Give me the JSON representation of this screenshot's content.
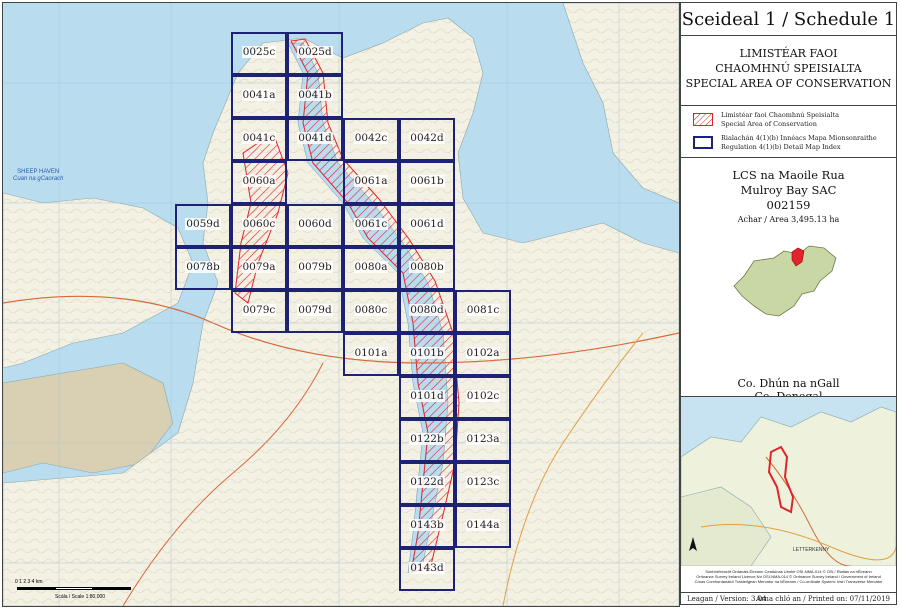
{
  "title": "Sceideal 1 / Schedule 1",
  "designation": {
    "line1": "LIMISTÉAR FAOI",
    "line2": "CHAOMHNÚ SPEISIALTA",
    "line3": "SPECIAL AREA OF CONSERVATION"
  },
  "legend": [
    {
      "line1": "Limistéar faoi Chaomhnú Speisialta",
      "line2": "Special Area of Conservation",
      "swatch": "hatch"
    },
    {
      "line1": "Rialachán 4(1)(b) Innéacs Mapa Mionsonraithe",
      "line2": "Regulation 4(1)(b) Detail Map Index",
      "swatch": "box"
    }
  ],
  "site": {
    "name_ga": "LCS na Maoile Rua",
    "name_en": "Mulroy Bay SAC",
    "code": "002159",
    "area": "Achar / Area 3,495.13 ha"
  },
  "county": {
    "ga": "Co. Dhún na nGall",
    "en": "Co. Donegal"
  },
  "map_labels": {
    "sheep_haven": "SHEEP HAVEN",
    "cuan": "Cuan na gCaorach",
    "letterkenny": "LETTERKENNY"
  },
  "scale": {
    "ticks": "0     1     2     3     4 km",
    "caption": "Scála / Scale 1:80,000"
  },
  "grid_cells": [
    {
      "label": "0025c",
      "col": 0,
      "row": 0
    },
    {
      "label": "0025d",
      "col": 1,
      "row": 0
    },
    {
      "label": "0041a",
      "col": 0,
      "row": 1
    },
    {
      "label": "0041b",
      "col": 1,
      "row": 1
    },
    {
      "label": "0041c",
      "col": 0,
      "row": 2
    },
    {
      "label": "0041d",
      "col": 1,
      "row": 2
    },
    {
      "label": "0042c",
      "col": 2,
      "row": 2
    },
    {
      "label": "0042d",
      "col": 3,
      "row": 2
    },
    {
      "label": "0060a",
      "col": 0,
      "row": 3
    },
    {
      "label": "0061a",
      "col": 2,
      "row": 3
    },
    {
      "label": "0061b",
      "col": 3,
      "row": 3
    },
    {
      "label": "0059d",
      "col": -1,
      "row": 4
    },
    {
      "label": "0060c",
      "col": 0,
      "row": 4
    },
    {
      "label": "0060d",
      "col": 1,
      "row": 4
    },
    {
      "label": "0061c",
      "col": 2,
      "row": 4
    },
    {
      "label": "0061d",
      "col": 3,
      "row": 4
    },
    {
      "label": "0078b",
      "col": -1,
      "row": 5
    },
    {
      "label": "0079a",
      "col": 0,
      "row": 5
    },
    {
      "label": "0079b",
      "col": 1,
      "row": 5
    },
    {
      "label": "0080a",
      "col": 2,
      "row": 5
    },
    {
      "label": "0080b",
      "col": 3,
      "row": 5
    },
    {
      "label": "0079c",
      "col": 0,
      "row": 6
    },
    {
      "label": "0079d",
      "col": 1,
      "row": 6
    },
    {
      "label": "0080c",
      "col": 2,
      "row": 6
    },
    {
      "label": "0080d",
      "col": 3,
      "row": 6
    },
    {
      "label": "0081c",
      "col": 4,
      "row": 6
    },
    {
      "label": "0101a",
      "col": 2,
      "row": 7
    },
    {
      "label": "0101b",
      "col": 3,
      "row": 7
    },
    {
      "label": "0102a",
      "col": 4,
      "row": 7
    },
    {
      "label": "0101d",
      "col": 3,
      "row": 8
    },
    {
      "label": "0102c",
      "col": 4,
      "row": 8
    },
    {
      "label": "0122b",
      "col": 3,
      "row": 9
    },
    {
      "label": "0123a",
      "col": 4,
      "row": 9
    },
    {
      "label": "0122d",
      "col": 3,
      "row": 10
    },
    {
      "label": "0123c",
      "col": 4,
      "row": 10
    },
    {
      "label": "0143b",
      "col": 3,
      "row": 11
    },
    {
      "label": "0144a",
      "col": 4,
      "row": 11
    },
    {
      "label": "0143d",
      "col": 3,
      "row": 12
    }
  ],
  "credits": {
    "line1": "Suirbhéireacht Ordanáis Éireann Ceadúnas Uimhir OSI-NMA-014 © OSi / Rialtas na hÉireann",
    "line2": "Ordnance Survey Ireland Licence No OSI-NMA-014 © Ordnance Survey Ireland / Government of Ireland",
    "line3": "Córas Comhordanáidí Trasteilgean Mercator na hÉireann / Co-ordinate System: Irish Transverse Mercator"
  },
  "version": "Leagan / Version: 3.04",
  "printed": "Arna chló an / Printed on: 07/11/2019",
  "colors": {
    "sac_red": "#e0242c",
    "grid_navy": "#1d2273",
    "land": "#f3f0e4",
    "water": "#b9dcef"
  }
}
